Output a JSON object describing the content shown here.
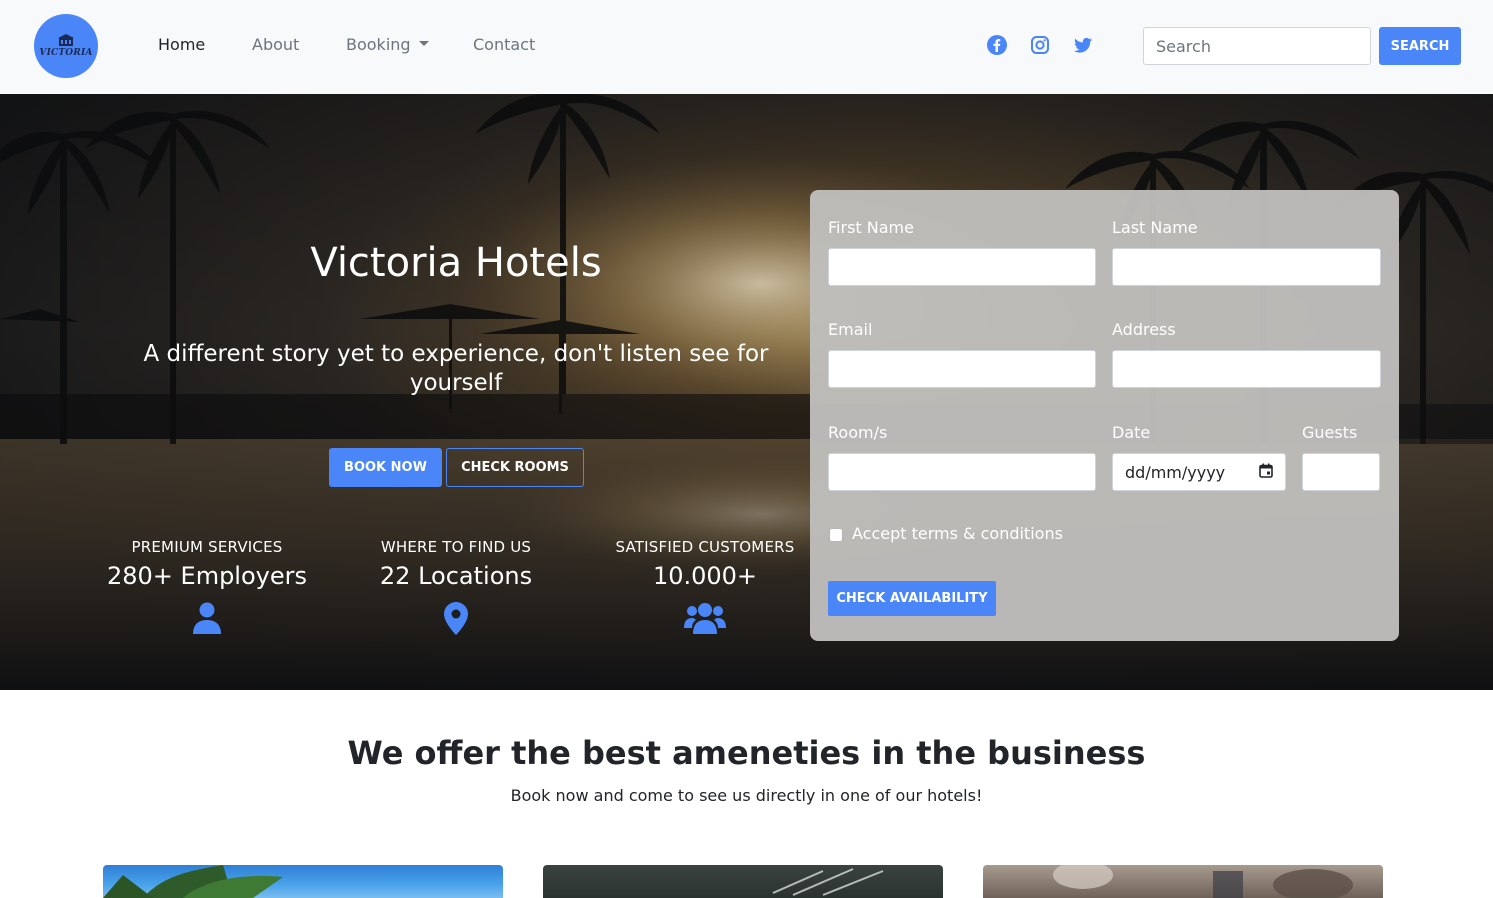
{
  "brand": {
    "logo_text": "VICTORIA"
  },
  "nav": {
    "links": [
      "Home",
      "About",
      "Booking",
      "Contact"
    ],
    "social_icons": [
      "facebook-icon",
      "instagram-icon",
      "twitter-icon"
    ]
  },
  "search": {
    "placeholder": "Search",
    "button_label": "SEARCH"
  },
  "hero": {
    "title": "Victoria Hotels",
    "subtitle": "A different story yet to experience, don't listen see for yourself",
    "book_label": "BOOK NOW",
    "check_label": "CHECK ROOMS",
    "stats": [
      {
        "label": "PREMIUM SERVICES",
        "value": "280+ Employers",
        "icon": "user-icon"
      },
      {
        "label": "WHERE TO FIND US",
        "value": "22 Locations",
        "icon": "map-marker-icon"
      },
      {
        "label": "SATISFIED CUSTOMERS",
        "value": "10.000+",
        "icon": "users-icon"
      }
    ]
  },
  "form": {
    "first_name_label": "First Name",
    "last_name_label": "Last Name",
    "email_label": "Email",
    "address_label": "Address",
    "rooms_label": "Room/s",
    "date_label": "Date",
    "date_placeholder": "dd/mm/yyyy",
    "guests_label": "Guests",
    "terms_label": "Accept terms & conditions",
    "submit_label": "CHECK AVAILABILITY"
  },
  "amenities": {
    "title": "We offer the best ameneties in the business",
    "subtitle": "Book now and come to see us directly in one of our hotels!"
  },
  "colors": {
    "accent": "#4a86f7",
    "navbar_bg": "#f8f9fa",
    "form_panel": "#c0bebc"
  }
}
